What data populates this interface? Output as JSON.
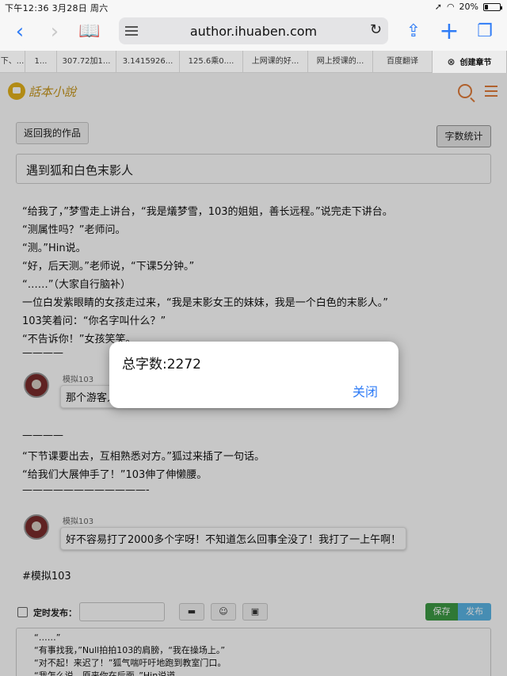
{
  "status_bar": {
    "time_date": "下午12:36   3月28日 周六",
    "battery": "20%",
    "battery_level": 0.2
  },
  "browser": {
    "url": "author.ihuaben.com",
    "tabs": [
      {
        "label": "下、..."
      },
      {
        "label": "1..."
      },
      {
        "label": "307.72加1..."
      },
      {
        "label": "3.1415926..."
      },
      {
        "label": "125.6乘0...."
      },
      {
        "label": "上网课的好..."
      },
      {
        "label": "网上授课的..."
      },
      {
        "label": "百度翻译"
      },
      {
        "label": "创建章节",
        "active": true
      }
    ]
  },
  "site": {
    "logo_text": "話本小說"
  },
  "editor": {
    "back_button": "返回我的作品",
    "word_count_button": "字数统计",
    "chapter_title": "遇到狐和白色末影人",
    "lines": [
      "“给我了，”梦雪走上讲台，“我是燨梦雪，103的姐姐，善长远程。”说完走下讲台。",
      "“测属性吗？”老师问。",
      "“测。”Hin说。",
      "“好，后天测。”老师说，“下课5分钟。”",
      "“……”（大家自行脑补）",
      "一位白发紫眼睛的女孩走过来，“我是末影女王的妹妹，我是一个白色的末影人。”",
      "103笑着问：“你名字叫什么？”",
      "“不告诉你！”女孩笑笑。",
      "————"
    ],
    "comment1": {
      "name": "模拟103",
      "text": "那个游客人"
    },
    "lines2": [
      "————",
      "“下节课要出去，互相熟悉对方。”狐过来插了一句话。",
      "“给我们大展伸手了！”103伸了伸懒腰。",
      "————————————-"
    ],
    "comment2": {
      "name": "模拟103",
      "text": "好不容易打了2000多个字呀！不知道怎么回事全没了！我打了一上午啊！"
    },
    "tag_line": "#模拟103",
    "schedule_label": "定时发布：",
    "save_button": "保存",
    "publish_button": "发布",
    "editor_lines": [
      "“……”",
      "“有事找我，”Null拍拍103的肩膀，“我在操场上。”",
      "“对不起！来迟了！”狐气喘吁吁地跑到教室门口。",
      "“我怎么说，原来你在后面。”Hin说道"
    ]
  },
  "dialog": {
    "message": "总字数:2272",
    "close_label": "关闭"
  }
}
